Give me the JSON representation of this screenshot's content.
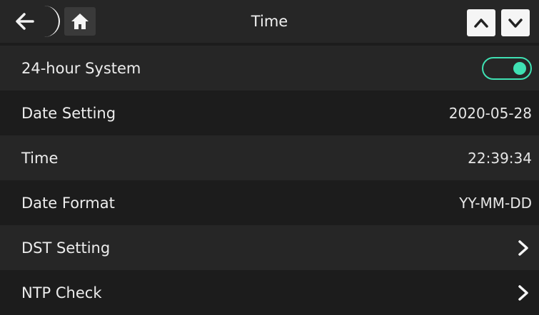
{
  "header": {
    "title": "Time",
    "back_icon": "back-arrow-icon",
    "home_icon": "home-icon",
    "up_icon": "chevron-up-icon",
    "down_icon": "chevron-down-icon"
  },
  "rows": [
    {
      "label": "24-hour System",
      "control": "toggle",
      "enabled": true
    },
    {
      "label": "Date Setting",
      "value": "2020-05-28"
    },
    {
      "label": "Time",
      "value": "22:39:34"
    },
    {
      "label": "Date Format",
      "value": "YY-MM-DD"
    },
    {
      "label": "DST Setting",
      "control": "chevron-right-icon"
    },
    {
      "label": "NTP Check",
      "control": "chevron-right-icon"
    }
  ],
  "colors": {
    "accent": "#3fe1b3",
    "header_bg": "#262626",
    "row_light": "#262626",
    "row_dark": "#1c1c1c"
  }
}
